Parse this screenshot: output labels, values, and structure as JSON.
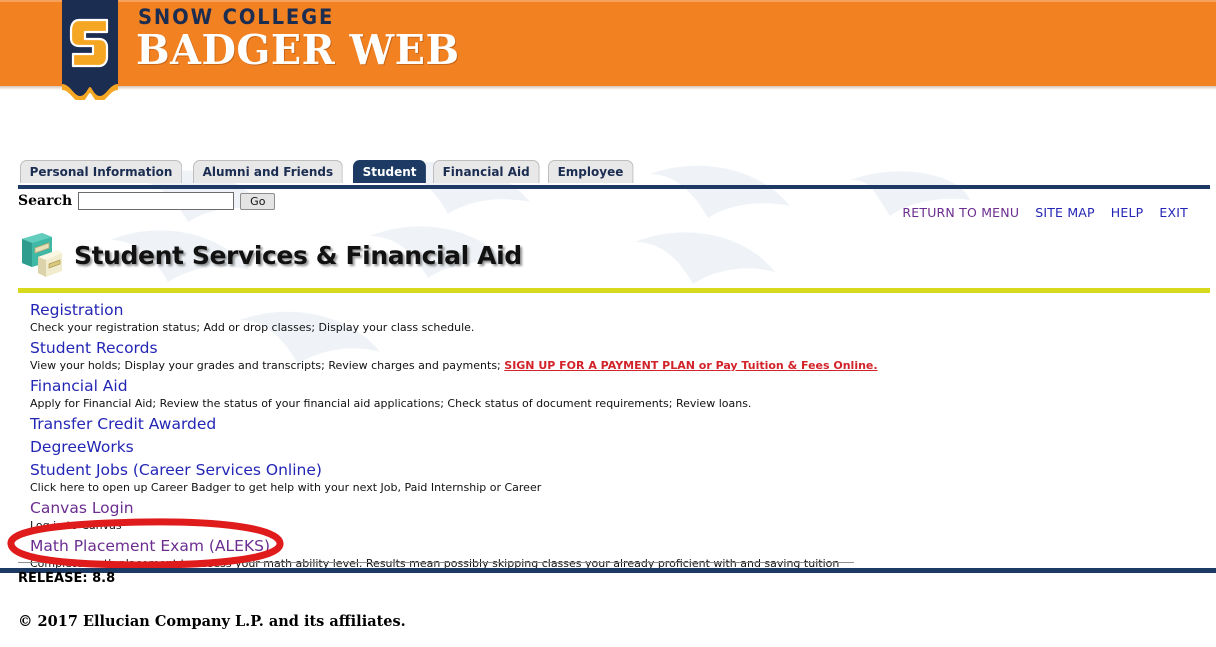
{
  "header": {
    "brand_line1": "SNOW COLLEGE",
    "brand_line2": "BADGER WEB",
    "logo_letter": "S",
    "orange": "#f28121",
    "navy": "#1c3a63"
  },
  "tabs": [
    {
      "label": "Personal Information",
      "active": false
    },
    {
      "label": "Alumni and Friends",
      "active": false
    },
    {
      "label": "Student",
      "active": true
    },
    {
      "label": "Financial Aid",
      "active": false
    },
    {
      "label": "Employee",
      "active": false
    }
  ],
  "search": {
    "label": "Search",
    "value": "",
    "placeholder": "",
    "button_label": "Go"
  },
  "topnav": [
    {
      "label": "RETURN TO MENU",
      "state": "visited"
    },
    {
      "label": "SITE MAP",
      "state": "unvisited"
    },
    {
      "label": "HELP",
      "state": "unvisited"
    },
    {
      "label": "EXIT",
      "state": "unvisited"
    }
  ],
  "page": {
    "title": "Student Services & Financial Aid",
    "icon": "filing-cabinet-icon"
  },
  "menu": [
    {
      "label": "Registration",
      "state": "unvisited",
      "desc": "Check your registration status; Add or drop classes; Display your class schedule.",
      "desc_highlight": ""
    },
    {
      "label": "Student Records",
      "state": "unvisited",
      "desc": "View your holds; Display your grades and transcripts; Review charges and payments; ",
      "desc_highlight": "SIGN UP FOR A PAYMENT PLAN or Pay Tuition & Fees Online."
    },
    {
      "label": "Financial Aid",
      "state": "unvisited",
      "desc": "Apply for Financial Aid; Review the status of your financial aid applications; Check status of document requirements; Review loans.",
      "desc_highlight": ""
    },
    {
      "label": "Transfer Credit Awarded",
      "state": "unvisited",
      "desc": "",
      "desc_highlight": ""
    },
    {
      "label": "DegreeWorks",
      "state": "unvisited",
      "desc": "",
      "desc_highlight": ""
    },
    {
      "label": "Student Jobs (Career Services Online)",
      "state": "unvisited",
      "desc": "Click here to open up Career Badger to get help with your next Job, Paid Internship or Career",
      "desc_highlight": ""
    },
    {
      "label": "Canvas Login",
      "state": "visited",
      "desc": "Log in to Canvas",
      "desc_highlight": ""
    },
    {
      "label": "Math Placement Exam (ALEKS)",
      "state": "visited",
      "desc": "Complete math placement to assess your math ability level. Results mean possibly skipping classes your already proficient with and saving tuition",
      "desc_highlight": ""
    }
  ],
  "annotation": {
    "target_label": "Math Placement Exam (ALEKS)",
    "color": "#e01b1b",
    "shape": "hand-drawn-ellipse"
  },
  "footer": {
    "release": "RELEASE: 8.8",
    "copyright": "© 2017 Ellucian Company L.P. and its affiliates."
  }
}
